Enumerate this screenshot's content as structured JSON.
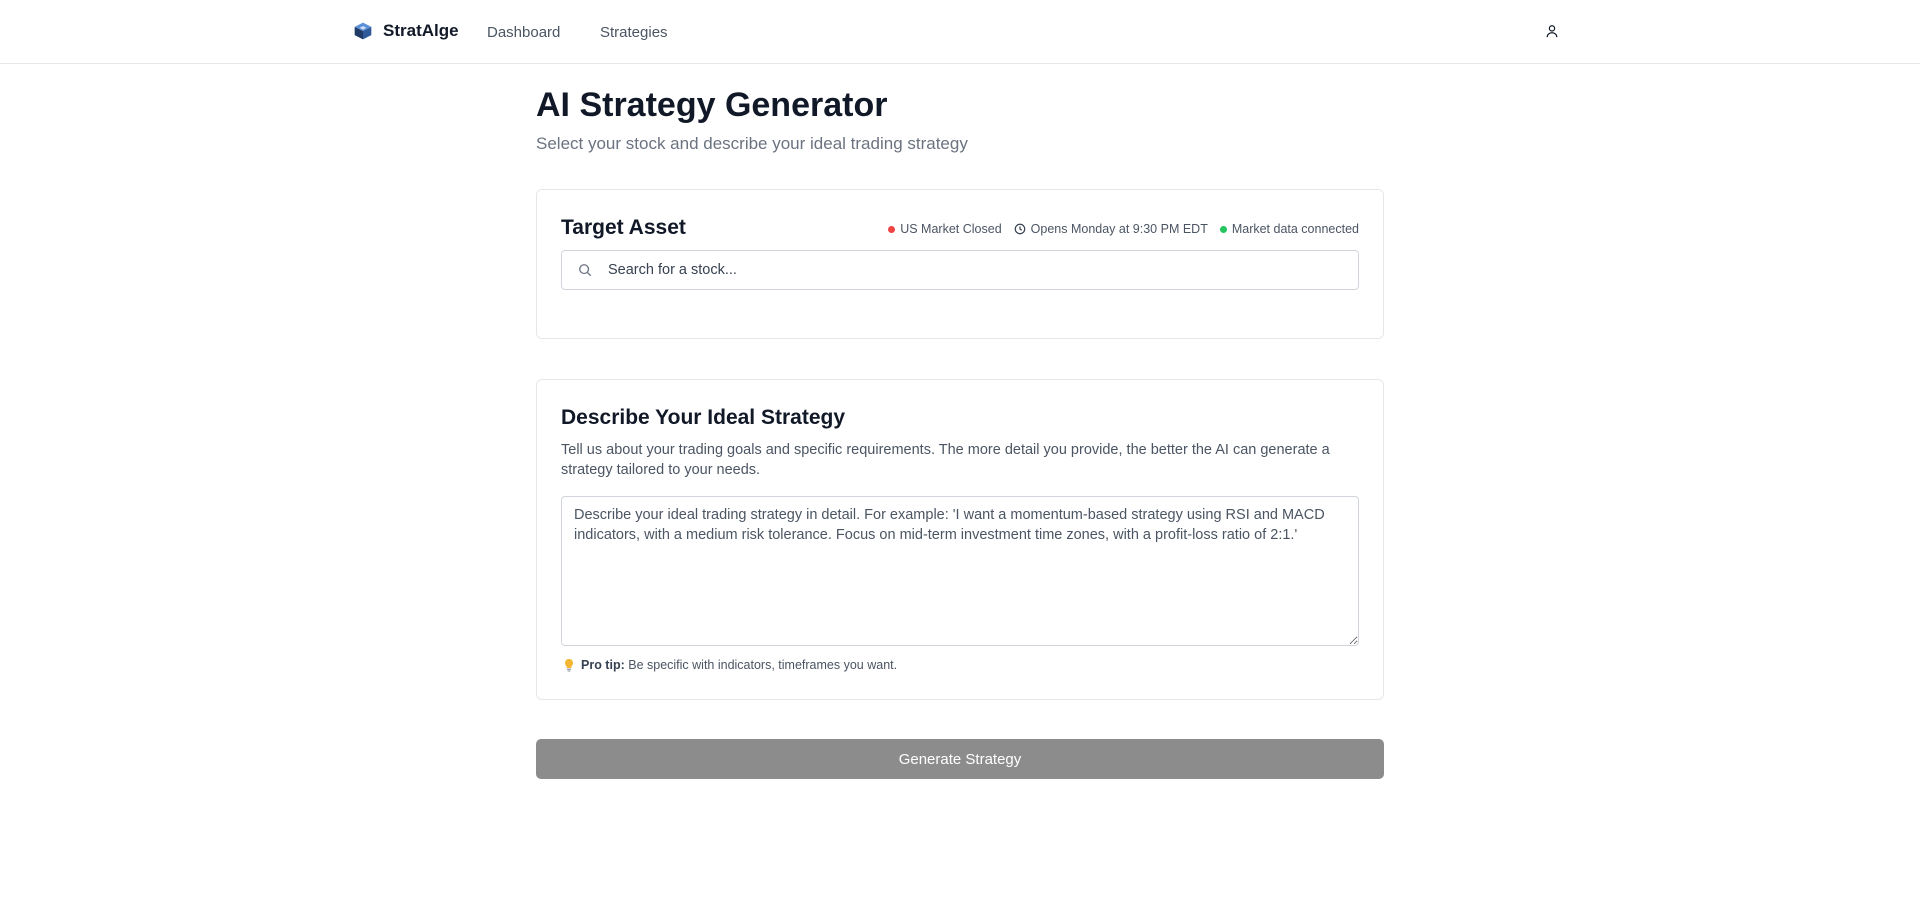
{
  "brand": {
    "name": "StratAlge",
    "logo_icon": "cube-logo-icon"
  },
  "nav": {
    "items": [
      {
        "label": "Dashboard"
      },
      {
        "label": "Strategies"
      }
    ]
  },
  "header": {
    "user_icon": "user-icon"
  },
  "page": {
    "title": "AI Strategy Generator",
    "subtitle": "Select your stock and describe your ideal trading strategy"
  },
  "asset_card": {
    "title": "Target Asset",
    "status": {
      "market": "US Market Closed",
      "opens": "Opens Monday at 9:30 PM EDT",
      "connection": "Market data connected"
    },
    "search": {
      "placeholder": "Search for a stock...",
      "value": ""
    }
  },
  "strategy_card": {
    "title": "Describe Your Ideal Strategy",
    "description": "Tell us about your trading goals and specific requirements. The more detail you provide, the better the AI can generate a strategy tailored to your needs.",
    "textarea": {
      "placeholder": "Describe your ideal trading strategy in detail. For example: 'I want a momentum-based strategy using RSI and MACD indicators, with a medium risk tolerance. Focus on mid-term investment time zones, with a profit-loss ratio of 2:1.'",
      "value": ""
    },
    "pro_tip": {
      "label": "Pro tip:",
      "text": "Be specific with indicators, timeframes you want."
    }
  },
  "actions": {
    "generate_label": "Generate Strategy"
  },
  "colors": {
    "status_closed": "#ef4444",
    "status_connected": "#22c55e",
    "button_disabled": "#8c8c8c",
    "border": "#e5e7eb"
  }
}
